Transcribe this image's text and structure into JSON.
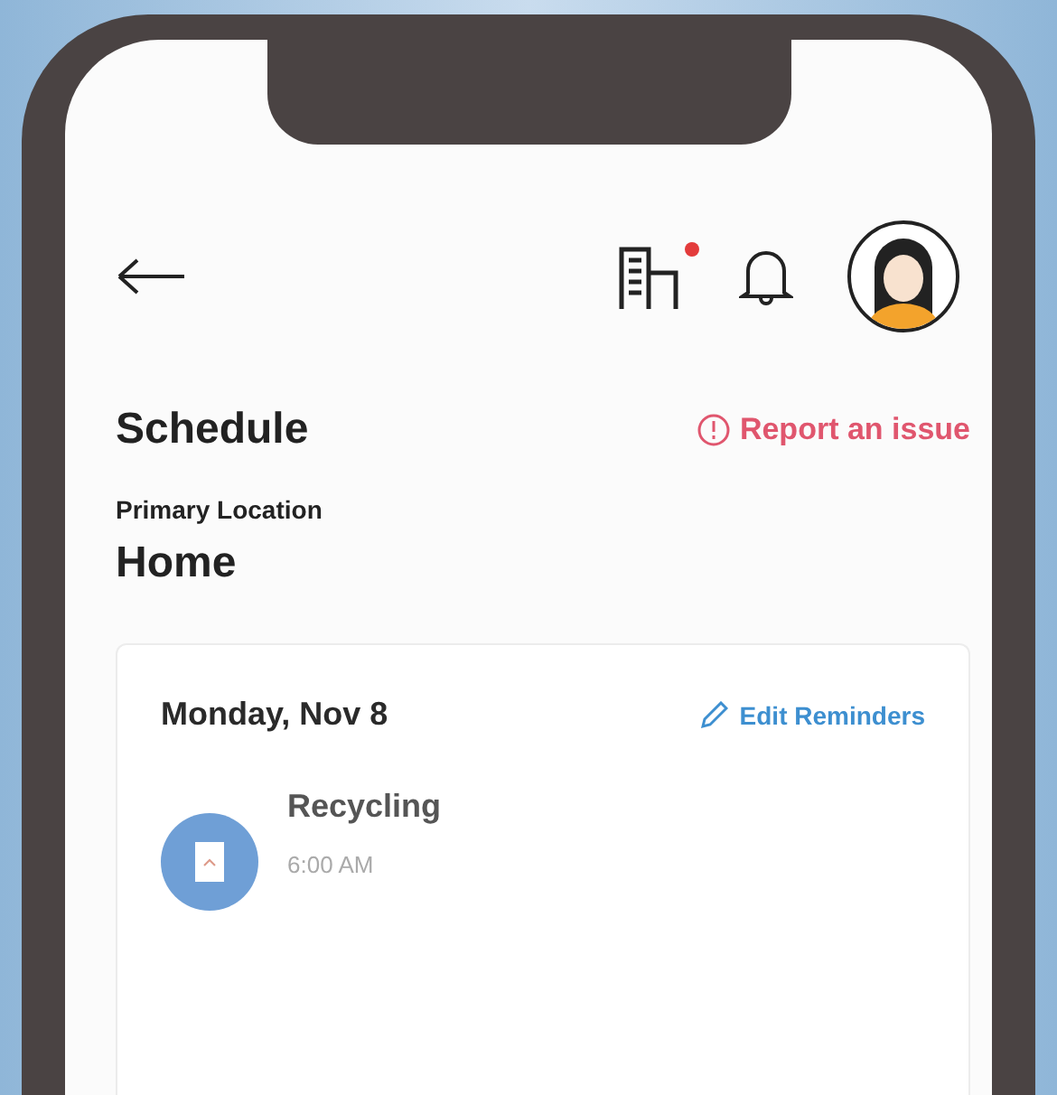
{
  "header": {
    "building_badge": true
  },
  "schedule": {
    "title": "Schedule",
    "report_link": "Report an issue"
  },
  "location": {
    "label": "Primary Location",
    "name": "Home"
  },
  "card": {
    "date": "Monday, Nov 8",
    "edit_link": "Edit Reminders",
    "items": [
      {
        "name": "Recycling",
        "time": "6:00 AM"
      }
    ]
  }
}
